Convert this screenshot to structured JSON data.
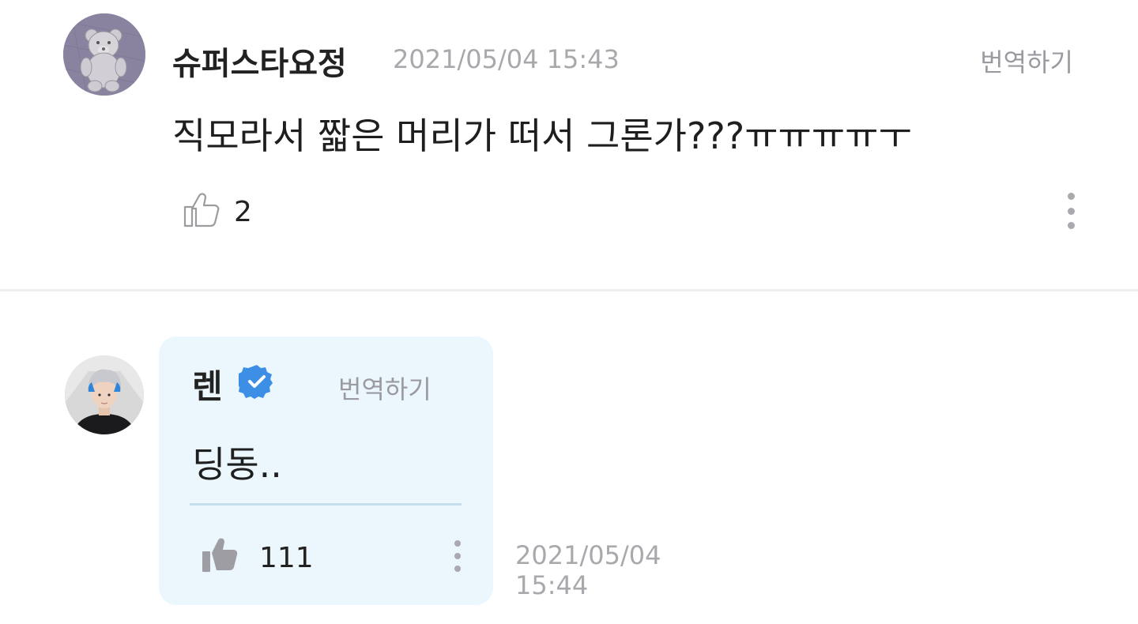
{
  "comments": [
    {
      "author": "슈퍼스타요정",
      "timestamp": "2021/05/04 15:43",
      "translate_label": "번역하기",
      "text": "직모라서 짧은 머리가 떠서 그론가???ㅠㅠㅠㅠㅜ",
      "likes": "2",
      "avatar_icon": "teddy-bear-avatar",
      "like_icon": "thumbs-up-outline-icon",
      "more_icon": "more-vertical-icon"
    }
  ],
  "reply": {
    "author": "렌",
    "verified_icon": "verified-badge-icon",
    "verified_color": "#3d8fe6",
    "translate_label": "번역하기",
    "text": "딩동..",
    "likes": "111",
    "date": "2021/05/04",
    "time": "15:44",
    "avatar_icon": "artist-avatar",
    "like_icon": "thumbs-up-filled-icon",
    "more_icon": "more-vertical-icon",
    "bubble_color": "#ebf7fd"
  }
}
